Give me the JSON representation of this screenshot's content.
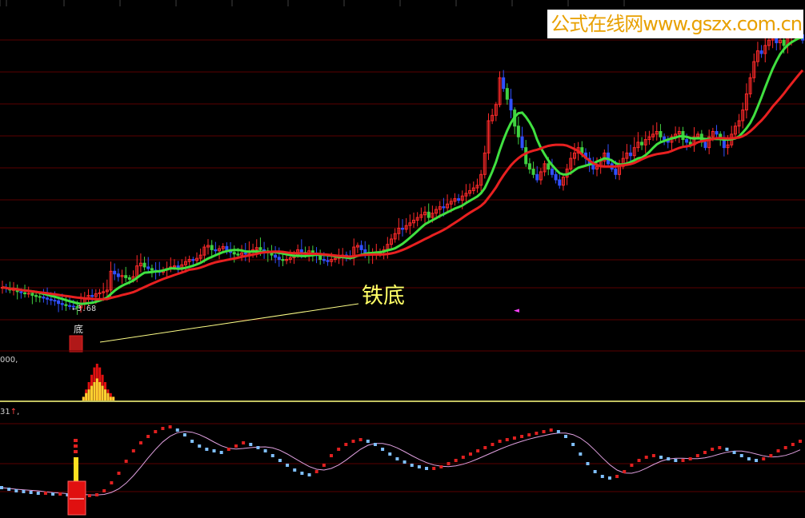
{
  "watermark": "公式在线网www.gszx.com.cn",
  "annotation": "铁底",
  "signal_label": "底",
  "low_price_label": "←3.68",
  "volume_label": "000,",
  "kdj_label_prefix": "31",
  "kdj_label_arrow": "↑",
  "kdj_label_suffix": ",",
  "pointer_glyph": "◄",
  "colors": {
    "up": "#ff2a2a",
    "down_blue": "#3050ff",
    "down_green": "#40d040",
    "ma_red": "#e82020",
    "ma_green": "#40e040",
    "grid": "#5a0000",
    "volume_red": "#e01010",
    "volume_yellow": "#ffd030",
    "kdj_rising": "#e02020",
    "kdj_falling": "#80c0ff",
    "kdj_smooth": "#e0a0e0"
  },
  "chart_data": [
    {
      "type": "candlestick",
      "title": "",
      "xlabel": "",
      "ylabel": "",
      "ylim": [
        3.2,
        9.0
      ],
      "grid": true,
      "annotations": [
        {
          "text": "铁底",
          "x": 20,
          "y": 3.68
        },
        {
          "text": "←3.68",
          "x": 20,
          "y": 3.68
        },
        {
          "text": "底",
          "x": 20,
          "y": 3.68
        }
      ],
      "x": [
        0,
        1,
        2,
        3,
        4,
        5,
        6,
        7,
        8,
        9,
        10,
        11,
        12,
        13,
        14,
        15,
        16,
        17,
        18,
        19,
        20,
        21,
        22,
        23,
        24,
        25,
        26,
        27,
        28,
        29,
        30,
        31,
        32,
        33,
        34,
        35,
        36,
        37,
        38,
        39,
        40,
        41,
        42,
        43,
        44,
        45,
        46,
        47,
        48,
        49,
        50,
        51,
        52,
        53,
        54,
        55,
        56,
        57,
        58,
        59,
        60,
        61,
        62,
        63,
        64,
        65,
        66,
        67,
        68,
        69,
        70,
        71,
        72,
        73,
        74,
        75,
        76,
        77,
        78,
        79,
        80,
        81,
        82,
        83,
        84,
        85,
        86,
        87,
        88,
        89,
        90,
        91,
        92,
        93,
        94,
        95,
        96,
        97,
        98,
        99,
        100,
        101,
        102,
        103,
        104,
        105,
        106,
        107,
        108,
        109,
        110,
        111,
        112,
        113,
        114,
        115,
        116,
        117,
        118,
        119,
        120,
        121,
        122,
        123,
        124,
        125,
        126,
        127,
        128,
        129,
        130,
        131,
        132,
        133,
        134,
        135,
        136,
        137,
        138,
        139,
        140,
        141,
        142,
        143,
        144,
        145,
        146,
        147,
        148,
        149,
        150,
        151,
        152,
        153,
        154,
        155,
        156,
        157,
        158,
        159,
        160,
        161,
        162,
        163,
        164,
        165,
        166,
        167,
        168,
        169,
        170,
        171,
        172,
        173,
        174,
        175,
        176,
        177,
        178,
        179,
        180,
        181,
        182,
        183,
        184,
        185,
        186,
        187,
        188,
        189,
        190,
        191,
        192,
        193,
        194,
        195,
        196,
        197,
        198,
        199,
        200,
        201,
        202,
        203,
        204,
        205,
        206,
        207,
        208,
        209
      ],
      "close": [
        4.1,
        4.08,
        4.05,
        4.06,
        4.02,
        4.0,
        3.98,
        3.99,
        3.95,
        3.93,
        3.92,
        3.9,
        3.88,
        3.86,
        3.85,
        3.8,
        3.78,
        3.76,
        3.75,
        3.74,
        3.72,
        3.8,
        3.9,
        3.95,
        3.93,
        3.98,
        4.0,
        4.02,
        4.05,
        4.4,
        4.35,
        4.3,
        4.32,
        4.28,
        4.25,
        4.3,
        4.5,
        4.55,
        4.48,
        4.45,
        4.42,
        4.4,
        4.38,
        4.42,
        4.45,
        4.48,
        4.5,
        4.47,
        4.52,
        4.58,
        4.62,
        4.6,
        4.64,
        4.7,
        4.85,
        4.88,
        4.8,
        4.78,
        4.82,
        4.86,
        4.8,
        4.75,
        4.72,
        4.7,
        4.74,
        4.72,
        4.76,
        4.8,
        4.84,
        4.8,
        4.78,
        4.74,
        4.7,
        4.66,
        4.62,
        4.6,
        4.62,
        4.65,
        4.7,
        4.8,
        4.75,
        4.72,
        4.78,
        4.74,
        4.7,
        4.62,
        4.6,
        4.58,
        4.62,
        4.64,
        4.66,
        4.7,
        4.68,
        4.66,
        4.85,
        4.88,
        4.8,
        4.75,
        4.7,
        4.72,
        4.74,
        4.76,
        4.8,
        4.9,
        5.0,
        5.1,
        5.2,
        5.18,
        5.25,
        5.3,
        5.35,
        5.4,
        5.45,
        5.5,
        5.4,
        5.48,
        5.55,
        5.6,
        5.58,
        5.65,
        5.7,
        5.75,
        5.72,
        5.8,
        5.85,
        5.9,
        5.95,
        6.0,
        6.2,
        6.6,
        7.2,
        7.3,
        7.5,
        8.0,
        7.8,
        7.6,
        7.4,
        7.1,
        6.9,
        6.7,
        6.4,
        6.3,
        6.2,
        6.1,
        6.25,
        6.4,
        6.3,
        6.2,
        6.1,
        6.0,
        6.15,
        6.3,
        6.5,
        6.6,
        6.7,
        6.6,
        6.5,
        6.4,
        6.3,
        6.35,
        6.45,
        6.6,
        6.4,
        6.3,
        6.2,
        6.35,
        6.5,
        6.6,
        6.55,
        6.7,
        6.8,
        6.75,
        6.85,
        6.9,
        6.95,
        7.0,
        6.9,
        6.85,
        6.8,
        6.9,
        6.95,
        7.0,
        6.85,
        6.8,
        6.75,
        6.9,
        6.95,
        6.8,
        6.7,
        6.9,
        7.0,
        6.95,
        6.85,
        6.7,
        6.75,
        6.95,
        7.1,
        7.2,
        7.4,
        7.7,
        8.0,
        8.3,
        8.5,
        8.45,
        8.6,
        8.7,
        8.8,
        8.65,
        8.7,
        8.6,
        8.75,
        8.85,
        8.9,
        8.8,
        8.7
      ],
      "ma_red_label": "",
      "ma_green_label": ""
    },
    {
      "type": "bar",
      "title": "",
      "series": [
        {
          "name": "",
          "values": [
            0,
            0,
            0,
            0,
            0,
            0,
            0,
            0,
            0,
            0,
            0,
            0,
            0,
            0,
            0,
            0,
            0,
            1,
            3,
            5,
            7,
            9,
            10,
            9,
            7,
            5,
            3,
            2,
            1,
            0
          ]
        }
      ],
      "stacked_inner": [
        0,
        0,
        0,
        0,
        0,
        0,
        0,
        0,
        0,
        0,
        0,
        0,
        0,
        0,
        0,
        0,
        0,
        1,
        2,
        3,
        4,
        5,
        6,
        5,
        4,
        3,
        2,
        1,
        1,
        0
      ]
    },
    {
      "type": "line",
      "title": "",
      "series": [
        {
          "name": "",
          "values": [
            12,
            10,
            8,
            7,
            6,
            5,
            5,
            4,
            4,
            3,
            3,
            2,
            2,
            3,
            8,
            18,
            30,
            45,
            58,
            68,
            76,
            82,
            86,
            88,
            84,
            78,
            70,
            64,
            60,
            58,
            56,
            60,
            64,
            68,
            66,
            62,
            58,
            52,
            46,
            40,
            34,
            30,
            28,
            32,
            40,
            52,
            60,
            66,
            70,
            72,
            70,
            66,
            60,
            54,
            48,
            44,
            40,
            38,
            36,
            36,
            38,
            42,
            46,
            50,
            54,
            58,
            62,
            66,
            70,
            72,
            74,
            76,
            78,
            80,
            82,
            84,
            82,
            76,
            66,
            54,
            42,
            32,
            26,
            24,
            26,
            32,
            40,
            46,
            50,
            52,
            50,
            48,
            46,
            46,
            48,
            52,
            56,
            60,
            62,
            60,
            56,
            52,
            48,
            46,
            48,
            52,
            58,
            62,
            66,
            70
          ]
        }
      ]
    }
  ]
}
